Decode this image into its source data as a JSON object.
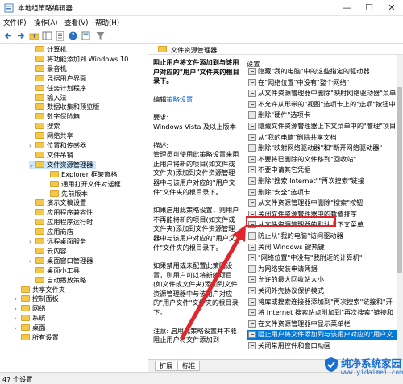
{
  "window": {
    "title": "本地组策略编辑器",
    "controls": {
      "minimize": "—",
      "maximize": "☐",
      "close": "✕"
    }
  },
  "menu": [
    "文件(F)",
    "操作(A)",
    "查看(V)",
    "帮助(H)"
  ],
  "toolbar_icons": [
    "back-icon",
    "forward-icon",
    "up-folder-icon",
    "show-tree-icon",
    "properties-icon",
    "help-icon",
    "export-icon",
    "filter-icon"
  ],
  "tree": [
    {
      "label": "计算机",
      "depth": 3,
      "expander": ""
    },
    {
      "label": "将功能添加到 Windows 10",
      "depth": 3,
      "expander": ""
    },
    {
      "label": "录音机",
      "depth": 3,
      "expander": ""
    },
    {
      "label": "凭据用户界面",
      "depth": 3,
      "expander": ""
    },
    {
      "label": "任务计划程序",
      "depth": 3,
      "expander": ""
    },
    {
      "label": "输入法",
      "depth": 3,
      "expander": ""
    },
    {
      "label": "数据收集和预览版",
      "depth": 3,
      "expander": ""
    },
    {
      "label": "数字保险箱",
      "depth": 3,
      "expander": ""
    },
    {
      "label": "搜索",
      "depth": 3,
      "expander": ""
    },
    {
      "label": "网络共享",
      "depth": 3,
      "expander": ""
    },
    {
      "label": "位置和传感器",
      "depth": 3,
      "expander": ">"
    },
    {
      "label": "文件吊销",
      "depth": 3,
      "expander": ""
    },
    {
      "label": "文件资源管理器",
      "depth": 3,
      "expander": "v",
      "selected": true
    },
    {
      "label": "Explorer 框架窗格",
      "depth": 4,
      "expander": ""
    },
    {
      "label": "通用打开文件对话框",
      "depth": 4,
      "expander": ""
    },
    {
      "label": "先前版本",
      "depth": 4,
      "expander": ""
    },
    {
      "label": "演示文稿设置",
      "depth": 3,
      "expander": ""
    },
    {
      "label": "应用程序兼容性",
      "depth": 3,
      "expander": ""
    },
    {
      "label": "应用程序运行时",
      "depth": 3,
      "expander": ""
    },
    {
      "label": "应用商店",
      "depth": 3,
      "expander": ""
    },
    {
      "label": "远程桌面服务",
      "depth": 3,
      "expander": ">"
    },
    {
      "label": "云内容",
      "depth": 3,
      "expander": ""
    },
    {
      "label": "桌面窗口管理器",
      "depth": 3,
      "expander": ">"
    },
    {
      "label": "桌面小工具",
      "depth": 3,
      "expander": ""
    },
    {
      "label": "自动播放策略",
      "depth": 3,
      "expander": ""
    },
    {
      "label": "共享文件夹",
      "depth": 2,
      "expander": ""
    },
    {
      "label": "控制面板",
      "depth": 2,
      "expander": ">"
    },
    {
      "label": "网络",
      "depth": 2,
      "expander": ">"
    },
    {
      "label": "系统",
      "depth": 2,
      "expander": ">"
    },
    {
      "label": "桌面",
      "depth": 2,
      "expander": ">"
    },
    {
      "label": "所有设置",
      "depth": 2,
      "expander": ""
    }
  ],
  "desc_header": "文件资源管理器",
  "description": {
    "title": "阻止用户将文件添加到与该用户对应的\"用户\"文件夹的根目录下。",
    "edit_prefix": "编辑",
    "edit_link": "策略设置",
    "requirement_label": "要求:",
    "requirement_text": "Windows Vista 及以上版本",
    "desc_label": "描述:",
    "desc_text": "管理员可使用此策略设置来阻止用户将新的项目(如文件或文件夹)添加到文件资源管理器中与该用户对应的\"用户文件\"文件夹的根目录下。",
    "enabled_text": "如果启用此策略设置，则用户不再能将新的项目(如文件或文件夹)添加到文件资源管理器中与该用户对应的\"用户文件\"文件夹的根目录下。",
    "disabled_text": "如果禁用或未配置此策略设置，则用户可以将新的项目(如文件或文件夹)添加到文件资源管理器中与该用户对应的\"用户文件\"文件夹的根目录下。",
    "note_text": "注意: 启用此策略设置并不能阻止用户将文件添加到"
  },
  "list_header": "设置",
  "settings": [
    "隐藏\"我的电脑\"中的这些指定的驱动器",
    "在\"网络位置\"中没有\"整个网络\"",
    "从文件资源管理器中删除\"映射网络驱动器\"菜单",
    "不允许从形带的\"视图\"选项卡上的\"选项\"按钮中",
    "删除\"硬件\"选项卡",
    "隐藏文件资源管理器上下文菜单中的\"管理\"项目",
    "从\"我的电脑\"删除共享文档",
    "删除\"映射网络驱动器\"和\"断开网络驱动器\"",
    "不要将已删除的文件移到\"回收站\"",
    "不要申请其它凭据",
    "删除\"搜索 Internet\"\"再次搜索\"链接",
    "删除\"安全\"选项卡",
    "从文件资源管理器中删除\"搜索\"按钮",
    "关闭文件资源管理器中的数值排序",
    "从文件资源管理器的默认上下文菜单",
    "防止从\"我的电脑\"访问驱动器",
    "关闭 Windows 键热键",
    "\"网络位置\"中没有\"我附近的计算机\"",
    "为网络安装申请凭据",
    "允许的最大回收站大小",
    "关闭外壳协议保护模式",
    "将库或搜索连接器添加到\"再次搜索\"链接和\"开",
    "将 Internet 搜索站点附加到\"再次搜索\"链接和",
    "在文件资源管理器中显示菜单栏",
    "阻止用户将文件添加到与该用户对应的\"用户文",
    "关闭常用控件和窗口动画"
  ],
  "selected_setting": "阻止用户将文件添加到与该用户对应的\"用户文",
  "highlighted_setting": "关闭 Windows 键热键",
  "tabs": [
    "扩展",
    "标准"
  ],
  "status_text": "47 个设置",
  "watermark": {
    "main": "纯净系统家园",
    "sub": "www.yidaimei.com"
  },
  "colors": {
    "selection": "#0078d7",
    "tree_selection": "#cce8ff",
    "annotation": "#e0262b",
    "link": "#0066cc",
    "watermark": "#1a6fd1"
  }
}
